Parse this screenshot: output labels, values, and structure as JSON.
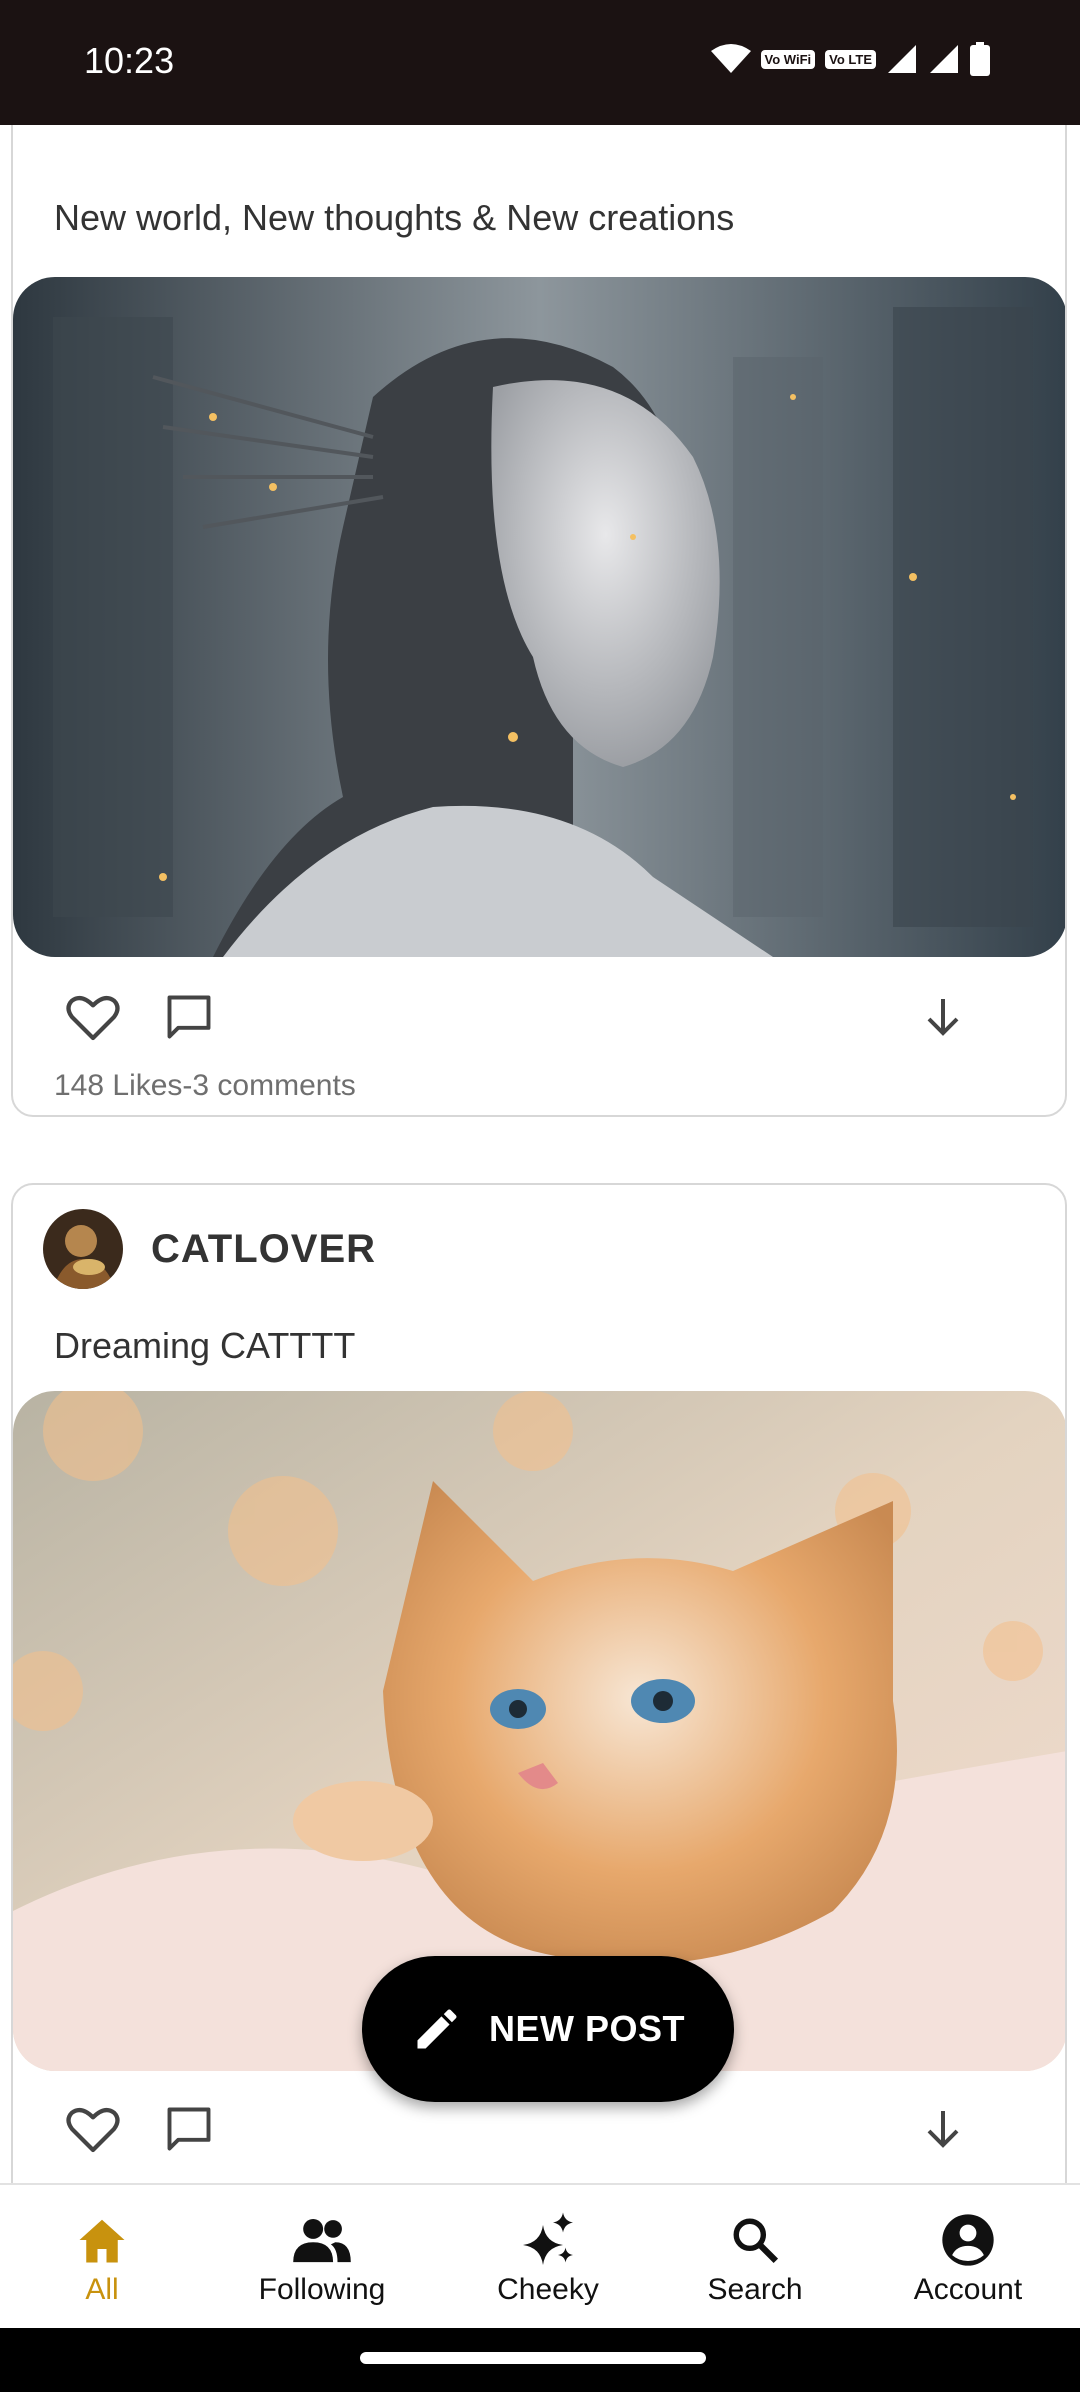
{
  "status_bar": {
    "time": "10:23",
    "wifi_badge": "Vo WiFi",
    "lte_badge": "Vo LTE",
    "icons": [
      "wifi-icon",
      "vowifi-icon",
      "volte-icon",
      "signal-icon",
      "signal-icon",
      "battery-icon"
    ]
  },
  "posts": [
    {
      "caption": "New world, New thoughts & New creations",
      "image": "robot-woman-image",
      "stats": "148 Likes-3 comments"
    },
    {
      "author": "CATLOVER",
      "caption": "Dreaming CATTTT",
      "image": "kitten-image"
    }
  ],
  "fab": {
    "label": "NEW POST",
    "icon": "pencil-icon"
  },
  "bottom_nav": {
    "items": [
      {
        "label": "All",
        "icon": "home-icon",
        "active": true
      },
      {
        "label": "Following",
        "icon": "people-icon",
        "active": false
      },
      {
        "label": "Cheeky",
        "icon": "sparkle-icon",
        "active": false
      },
      {
        "label": "Search",
        "icon": "search-icon",
        "active": false
      },
      {
        "label": "Account",
        "icon": "account-icon",
        "active": false
      }
    ]
  },
  "colors": {
    "accent": "#c8920e",
    "status_bar": "#1b1212",
    "fab": "#000000"
  }
}
